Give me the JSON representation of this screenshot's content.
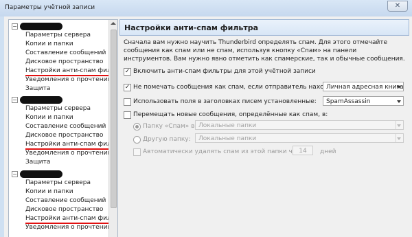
{
  "window": {
    "title": "Параметры учётной записи",
    "close_glyph": "✕"
  },
  "tree": {
    "accounts": [
      {
        "expand_glyph": "−",
        "items": [
          "Параметры сервера",
          "Копии и папки",
          "Составление сообщений и ...",
          "Дисковое пространство",
          "Настройки анти-спам филь...",
          "Уведомления о прочтении",
          "Защита"
        ]
      },
      {
        "expand_glyph": "−",
        "items": [
          "Параметры сервера",
          "Копии и папки",
          "Составление сообщений и ...",
          "Дисковое пространство",
          "Настройки анти-спам филь...",
          "Уведомления о прочтении",
          "Защита"
        ]
      },
      {
        "expand_glyph": "−",
        "items": [
          "Параметры сервера",
          "Копии и папки",
          "Составление сообщений и ...",
          "Дисковое пространство",
          "Настройки анти-спам филь...",
          "Уведомления о прочтении"
        ]
      }
    ],
    "highlight_color": "#e11111"
  },
  "panel": {
    "title": "Настройки анти-спам фильтра",
    "intro": "Сначала вам нужно научить Thunderbird определять спам. Для этого отмечайте сообщения как спам или не спам, используя кнопку «Спам» на панели инструментов. Вам нужно явно отметить как спамерские, так и обычные сообщения.",
    "enable_filter": {
      "label": "Включить анти-спам фильтры для этой учётной записи",
      "checked": true
    },
    "not_spam_sender": {
      "label": "Не помечать сообщения как спам, если отправитель находится в:",
      "checked": true,
      "select": "Личная адресная книга"
    },
    "use_headers": {
      "label": "Использовать поля в заголовках писем установленные:",
      "checked": false,
      "select": "SpamAssassin"
    },
    "move_spam": {
      "label": "Перемещать новые сообщения, определённые как спам, в:",
      "checked": false
    },
    "spam_folder": {
      "label": "Папку «Спам» в:",
      "select": "Локальные папки",
      "selected": true
    },
    "other_folder": {
      "label": "Другую папку:",
      "select": "Локальные папки",
      "selected": false
    },
    "auto_delete": {
      "label": "Автоматически удалять спам из этой папки через",
      "days": "14",
      "days_unit": "дней",
      "checked": false
    },
    "check_glyph": "✓"
  }
}
